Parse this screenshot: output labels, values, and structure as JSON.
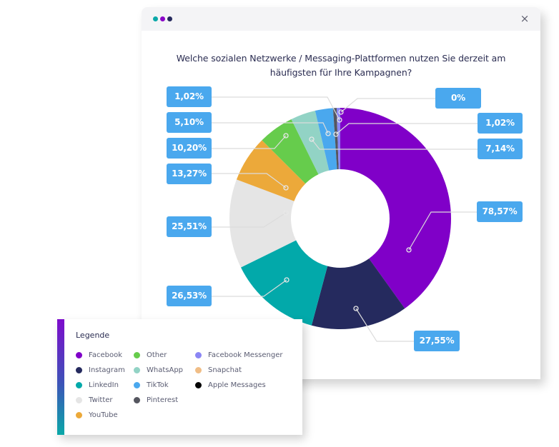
{
  "window": {
    "dots": [
      {
        "name": "teal-dot",
        "color": "#0aa8a8"
      },
      {
        "name": "purple-dot",
        "color": "#8a06c8"
      },
      {
        "name": "navy-dot",
        "color": "#262a5e"
      }
    ],
    "close_icon": "×"
  },
  "title": {
    "line1": "Welche sozialen Netzwerke / Messaging-Plattformen nutzen Sie derzeit am",
    "line2": "häufigsten für Ihre Kampagnen?"
  },
  "chart_data": {
    "type": "pie",
    "variant": "donut",
    "title": "Welche sozialen Netzwerke / Messaging-Plattformen nutzen Sie derzeit am häufigsten für Ihre Kampagnen?",
    "start": "top",
    "direction": "clockwise",
    "slices": [
      {
        "name": "Facebook",
        "value": 78.57,
        "label": "78,57%",
        "color": "#8000c8"
      },
      {
        "name": "Instagram",
        "value": 27.55,
        "label": "27,55%",
        "color": "#252a5e"
      },
      {
        "name": "LinkedIn",
        "value": 26.53,
        "label": "26,53%",
        "color": "#02a9aa"
      },
      {
        "name": "Twitter",
        "value": 25.51,
        "label": "25,51%",
        "color": "#e5e5e5"
      },
      {
        "name": "YouTube",
        "value": 13.27,
        "label": "13,27%",
        "color": "#eca93a"
      },
      {
        "name": "Other",
        "value": 10.2,
        "label": "10,20%",
        "color": "#66cc4c"
      },
      {
        "name": "WhatsApp",
        "value": 7.14,
        "label": "7,14%",
        "color": "#92d3c5"
      },
      {
        "name": "TikTok",
        "value": 5.1,
        "label": "5,10%",
        "color": "#4aa8ee"
      },
      {
        "name": "Pinterest",
        "value": 1.02,
        "label": "1,02%",
        "color": "#55565f"
      },
      {
        "name": "Facebook Messenger",
        "value": 1.02,
        "label": "1,02%",
        "color": "#8b86f4"
      },
      {
        "name": "Snapchat",
        "value": 0,
        "label": "0%",
        "color": "#f0bd86"
      }
    ],
    "label_color": "#4aa8ee",
    "leader_color": "#dcdcdc"
  },
  "legend": {
    "title": "Legende",
    "columns": [
      [
        {
          "label": "Facebook",
          "color": "#8000c8"
        },
        {
          "label": "Instagram",
          "color": "#252a5e"
        },
        {
          "label": "LinkedIn",
          "color": "#02a9aa"
        },
        {
          "label": "Twitter",
          "color": "#e5e5e5"
        },
        {
          "label": "YouTube",
          "color": "#eca93a"
        }
      ],
      [
        {
          "label": "Other",
          "color": "#66cc4c"
        },
        {
          "label": "WhatsApp",
          "color": "#92d3c5"
        },
        {
          "label": "TikTok",
          "color": "#4aa8ee"
        },
        {
          "label": "Pinterest",
          "color": "#55565f"
        }
      ],
      [
        {
          "label": "Facebook Messenger",
          "color": "#8b86f4"
        },
        {
          "label": "Snapchat",
          "color": "#f0bd86"
        },
        {
          "label": "Apple Messages",
          "color": "#050505"
        }
      ]
    ]
  }
}
